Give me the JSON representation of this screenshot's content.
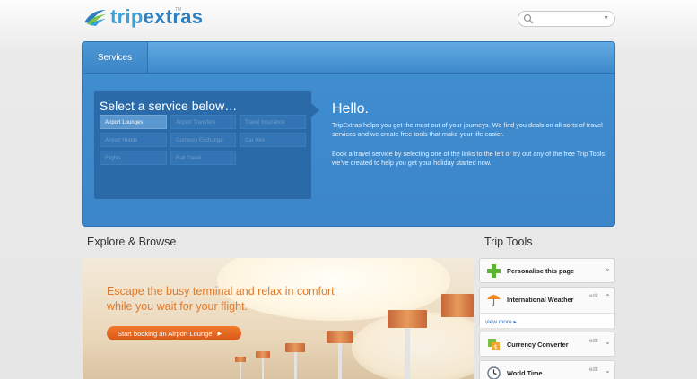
{
  "header": {
    "logo_trip": "trip",
    "logo_extras": "extras",
    "logo_tm": "TM",
    "search_placeholder": ""
  },
  "panel": {
    "tab_label": "Services",
    "select_title": "Select a service below…",
    "services": [
      {
        "label": "Airport Lounges",
        "active": true
      },
      {
        "label": "Airport Transfers",
        "active": false
      },
      {
        "label": "Travel Insurance",
        "active": false
      },
      {
        "label": "Airport Hotels",
        "active": false
      },
      {
        "label": "Currency Exchange",
        "active": false
      },
      {
        "label": "Car Hire",
        "active": false
      },
      {
        "label": "Flights",
        "active": false
      },
      {
        "label": "Rail Travel",
        "active": false
      }
    ],
    "hello_title": "Hello.",
    "hello_p1": "TripExtras helps you get the most out of your journeys. We find you deals on all sorts of travel services and we create free tools that make your life easier.",
    "hello_p2": "Book a travel service by selecting one of the links to the left or try out any of the free Trip Tools we’ve created to help you get your holiday started now."
  },
  "explore": {
    "title": "Explore & Browse",
    "banner_line1": "Escape the busy terminal and relax in comfort",
    "banner_line2": "while you wait for your flight.",
    "banner_button": "Start booking an Airport Lounge"
  },
  "trip_tools": {
    "title": "Trip Tools",
    "tools": [
      {
        "label": "Personalise this page",
        "edit": "",
        "chevron": "⌄",
        "icon": "plus-icon",
        "more": ""
      },
      {
        "label": "International Weather",
        "edit": "edit",
        "chevron": "⌃",
        "icon": "umbrella-icon",
        "more": "view more"
      },
      {
        "label": "Currency Converter",
        "edit": "edit",
        "chevron": "⌄",
        "icon": "currency-icon",
        "more": ""
      },
      {
        "label": "World Time",
        "edit": "edit",
        "chevron": "⌄",
        "icon": "clock-icon",
        "more": ""
      }
    ]
  },
  "colors": {
    "brand_blue": "#3c86c9",
    "accent_orange": "#e07a2c",
    "link_blue": "#3b78c0"
  }
}
